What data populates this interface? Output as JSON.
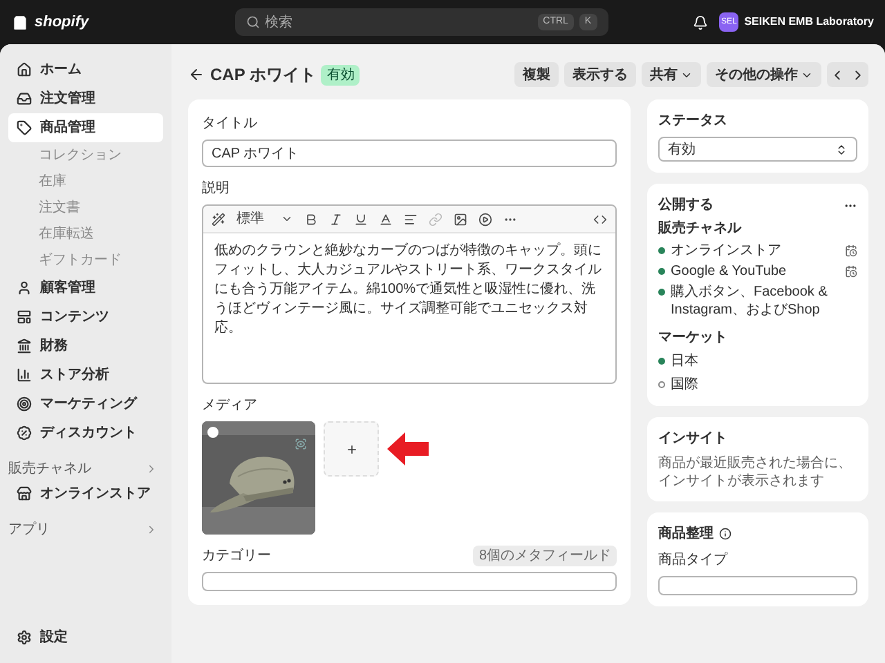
{
  "top_bar": {
    "logo": "shopify",
    "search": {
      "placeholder": "検索",
      "keys": [
        "CTRL",
        "K"
      ]
    },
    "avatar": "SEL",
    "store": "SEIKEN EMB Laboratory"
  },
  "sidebar": {
    "items": [
      {
        "label": "ホーム",
        "selected": false
      },
      {
        "label": "注文管理",
        "selected": false
      },
      {
        "label": "商品管理",
        "selected": true,
        "children": [
          {
            "label": "コレクション",
            "selected": false
          },
          {
            "label": "在庫",
            "selected": false
          },
          {
            "label": "注文書",
            "selected": false
          },
          {
            "label": "在庫転送",
            "selected": false
          },
          {
            "label": "ギフトカード",
            "selected": false
          }
        ]
      },
      {
        "label": "顧客管理",
        "selected": false
      },
      {
        "label": "コンテンツ",
        "selected": false
      },
      {
        "label": "財務",
        "selected": false
      },
      {
        "label": "ストア分析",
        "selected": false
      },
      {
        "label": "マーケティング",
        "selected": false
      },
      {
        "label": "ディスカウント",
        "selected": false
      }
    ],
    "sections": [
      {
        "label": "販売チャネル",
        "items": [
          {
            "label": "オンラインストア",
            "selected": false
          }
        ]
      },
      {
        "label": "アプリ"
      }
    ],
    "footer": {
      "label": "設定"
    }
  },
  "product": {
    "title": "CAP ホワイト",
    "badge": "有効",
    "actions": [
      {
        "label": "複製",
        "kind": "plain"
      },
      {
        "label": "表示する",
        "kind": "plain"
      },
      {
        "label": "共有",
        "kind": "menu"
      },
      {
        "label": "その他の操作",
        "kind": "menu"
      }
    ]
  },
  "form": {
    "title_label": "タイトル",
    "title_value": "CAP ホワイト",
    "description_label": "説明",
    "editor_format": "標準",
    "description": "低めのクラウンと絶妙なカーブのつばが特徴のキャップ。頭にフィットし、大人カジュアルやストリート系、ワークスタイルにも合う万能アイテム。綿100%で通気性と吸湿性に優れ、洗うほどヴィンテージ風に。サイズ調整可能でユニセックス対応。",
    "media_label": "メディア",
    "category_label": "カテゴリー",
    "metafields": "8個のメタフィールド"
  },
  "status_card": {
    "title": "ステータス",
    "value": "有効"
  },
  "publish_card": {
    "title": "公開する",
    "channels_label": "販売チャネル",
    "channels": [
      {
        "name": "オンラインストア",
        "active": true,
        "schedule_icon": true
      },
      {
        "name": "Google & YouTube",
        "active": true,
        "schedule_icon": true
      },
      {
        "name": "購入ボタン、Facebook & Instagram、およびShop",
        "active": true,
        "schedule_icon": false
      }
    ],
    "markets_label": "マーケット",
    "markets": [
      {
        "name": "日本",
        "active": true
      },
      {
        "name": "国際",
        "active": false
      }
    ]
  },
  "insights_card": {
    "title": "インサイト",
    "text": "商品が最近販売された場合に、インサイトが表示されます"
  },
  "organization_card": {
    "title": "商品整理",
    "type_label": "商品タイプ"
  }
}
